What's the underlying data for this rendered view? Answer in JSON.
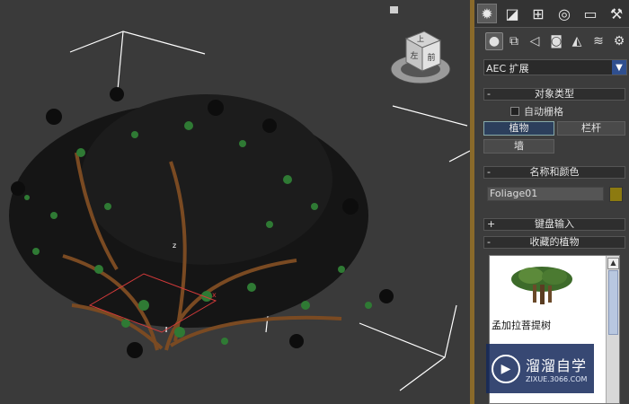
{
  "command_panel": {
    "tabs": [
      {
        "name": "create-tab",
        "glyph": "✹",
        "active": true
      },
      {
        "name": "modify-tab",
        "glyph": "◪"
      },
      {
        "name": "hierarchy-tab",
        "glyph": "⊞"
      },
      {
        "name": "motion-tab",
        "glyph": "◎"
      },
      {
        "name": "display-tab",
        "glyph": "▭"
      },
      {
        "name": "utilities-tab",
        "glyph": "⚒"
      }
    ],
    "subcategories": [
      {
        "name": "geometry-icon",
        "glyph": "●"
      },
      {
        "name": "shapes-icon",
        "glyph": "⧉"
      },
      {
        "name": "lights-icon",
        "glyph": "◁"
      },
      {
        "name": "cameras-icon",
        "glyph": "◙"
      },
      {
        "name": "helpers-icon",
        "glyph": "◭"
      },
      {
        "name": "spacewarps-icon",
        "glyph": "≋"
      },
      {
        "name": "systems-icon",
        "glyph": "⚙"
      }
    ],
    "category_dropdown": {
      "value": "AEC 扩展",
      "arrow": "▼"
    },
    "object_type": {
      "title": "对象类型",
      "autogrid_label": "自动栅格",
      "buttons": [
        "植物",
        "栏杆",
        "墙"
      ]
    },
    "name_color": {
      "title": "名称和颜色",
      "object_name": "Foliage01",
      "color": "#8c7a10"
    },
    "keyboard_input": {
      "title": "键盘输入"
    },
    "favorite_plants": {
      "title": "收藏的植物",
      "plant_name": "孟加拉菩提树"
    },
    "collapse_symbol": "-",
    "expand_symbol": "+"
  },
  "viewport": {
    "viewcube_labels": [
      "上",
      "前",
      "左"
    ]
  },
  "watermark": {
    "brand": "溜溜自学",
    "url": "ZIXUE.3066.COM"
  }
}
